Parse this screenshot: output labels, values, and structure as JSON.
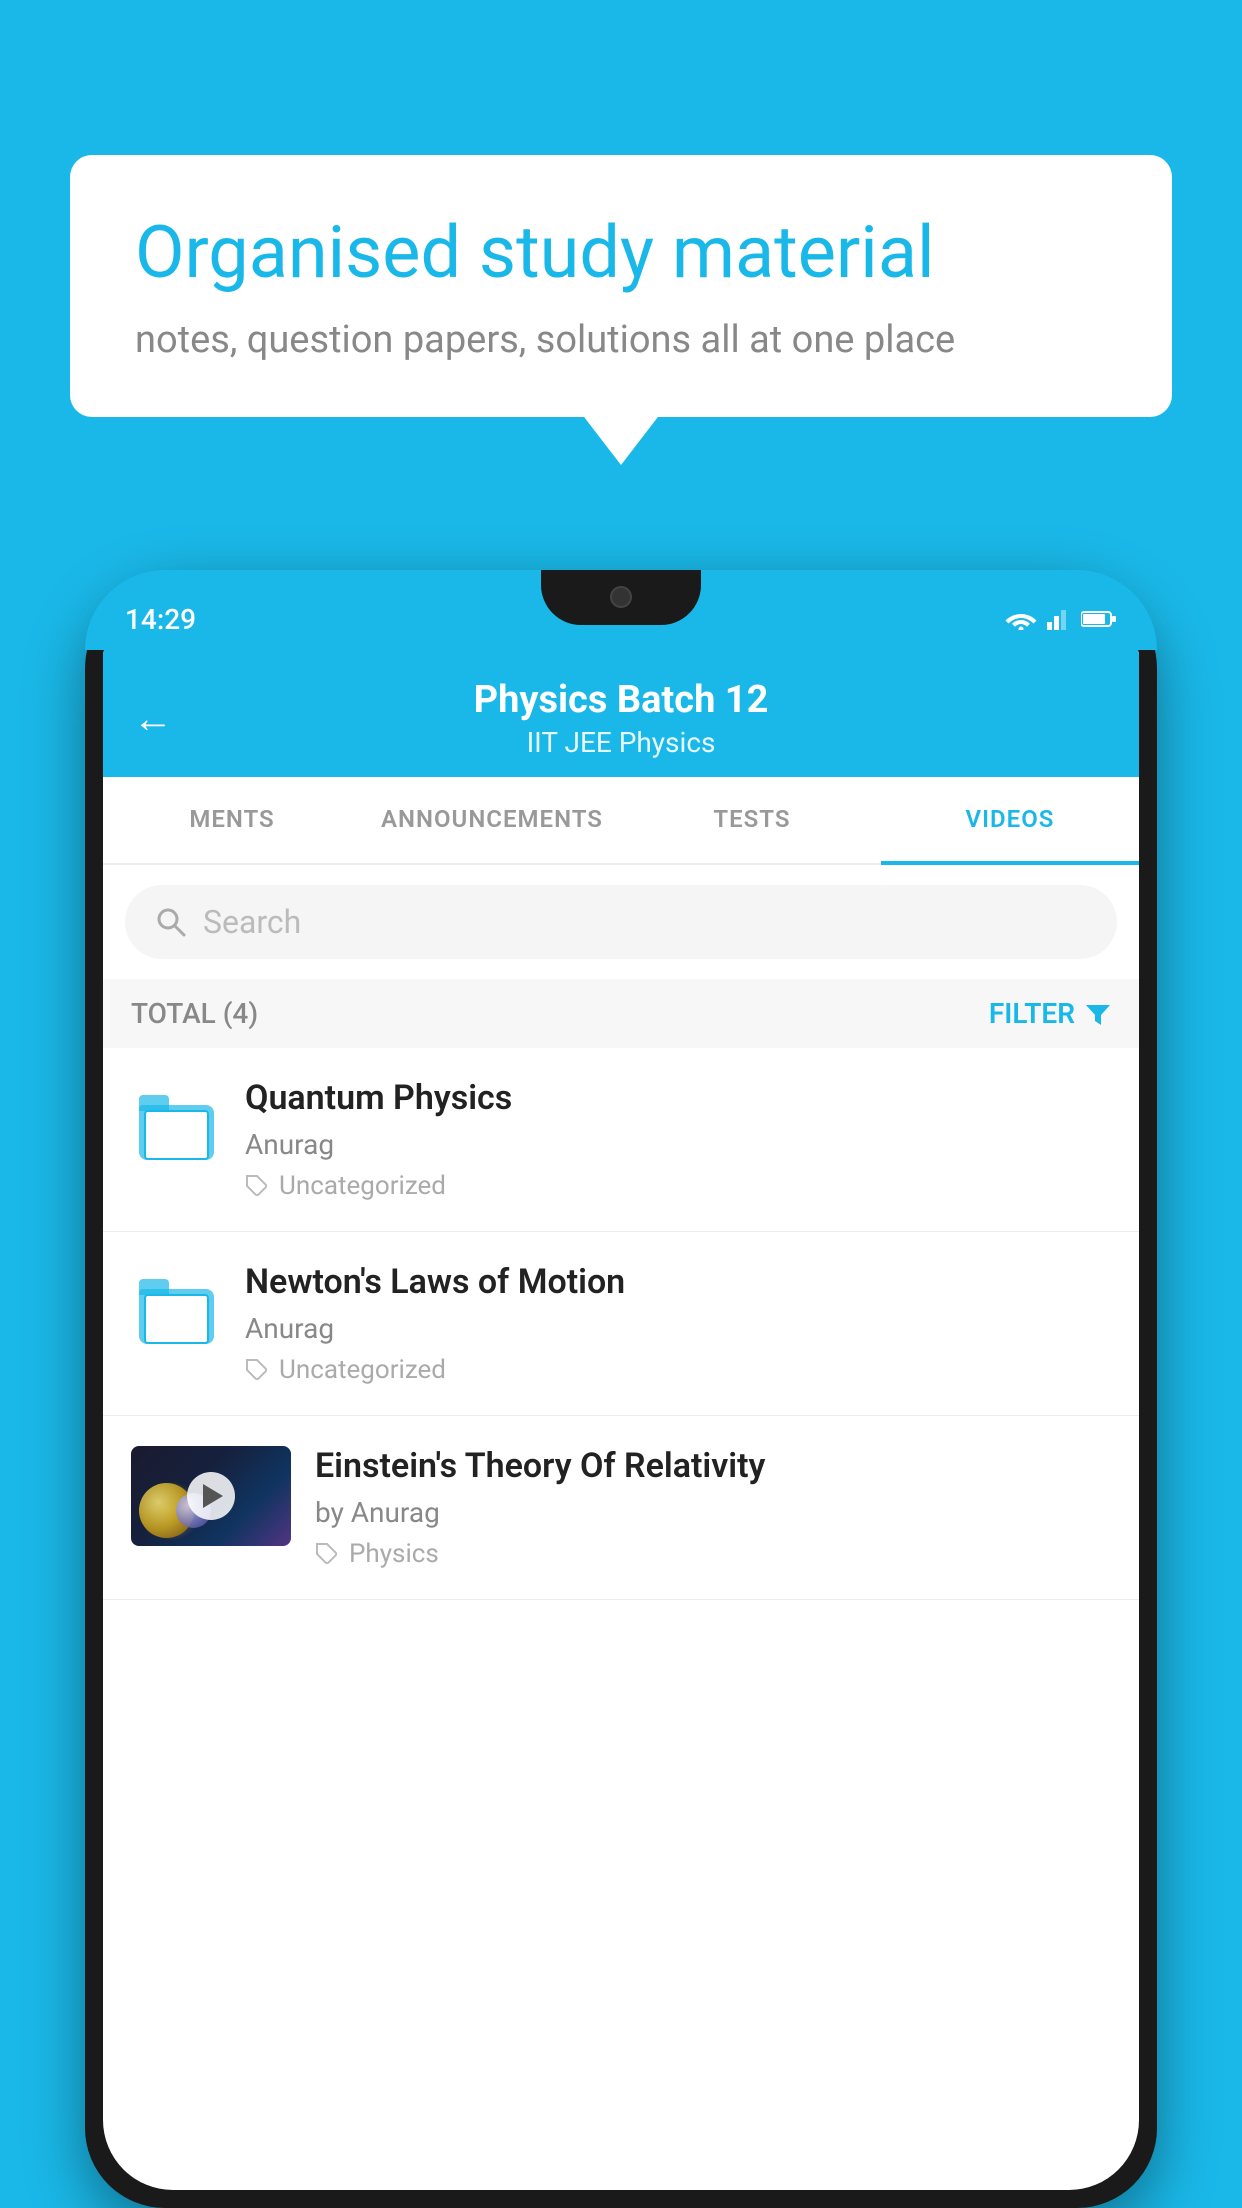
{
  "background_color": "#1ab8e8",
  "bubble": {
    "title": "Organised study material",
    "subtitle": "notes, question papers, solutions all at one place"
  },
  "phone": {
    "status_time": "14:29",
    "header": {
      "title": "Physics Batch 12",
      "subtitle_tags": "IIT JEE    Physics",
      "back_label": "←"
    },
    "tabs": [
      {
        "label": "MENTS",
        "active": false
      },
      {
        "label": "ANNOUNCEMENTS",
        "active": false
      },
      {
        "label": "TESTS",
        "active": false
      },
      {
        "label": "VIDEOS",
        "active": true
      }
    ],
    "search": {
      "placeholder": "Search"
    },
    "filter_row": {
      "total_label": "TOTAL (4)",
      "filter_label": "FILTER"
    },
    "videos": [
      {
        "title": "Quantum Physics",
        "author": "Anurag",
        "tag": "Uncategorized",
        "type": "folder"
      },
      {
        "title": "Newton's Laws of Motion",
        "author": "Anurag",
        "tag": "Uncategorized",
        "type": "folder"
      },
      {
        "title": "Einstein's Theory Of Relativity",
        "author": "by Anurag",
        "tag": "Physics",
        "type": "video"
      }
    ]
  }
}
